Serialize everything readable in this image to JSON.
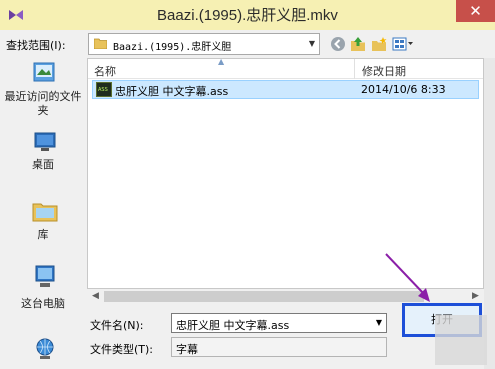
{
  "window": {
    "title": "Baazi.(1995).忠肝义胆.mkv",
    "close_glyph": "✕"
  },
  "lookin": {
    "label": "查找范围(I):",
    "folder": "Baazi.(1995).忠肝义胆"
  },
  "places": [
    {
      "label": "最近访问的文件夹",
      "icon": "recent-places-icon"
    },
    {
      "label": "桌面",
      "icon": "desktop-icon"
    },
    {
      "label": "库",
      "icon": "libraries-icon"
    },
    {
      "label": "这台电脑",
      "icon": "this-pc-icon"
    }
  ],
  "columns": {
    "name": "名称",
    "date": "修改日期"
  },
  "files": [
    {
      "name": "忠肝义胆 中文字幕.ass",
      "date": "2014/10/6 8:33",
      "icon_text": "ASS",
      "selected": true
    }
  ],
  "filename": {
    "label": "文件名(N):",
    "value": "忠肝义胆 中文字幕.ass"
  },
  "filetype": {
    "label": "文件类型(T):",
    "value": "字幕"
  },
  "open_button": {
    "label": "打开"
  },
  "colors": {
    "titlebar": "#f6f0b3",
    "selection": "#cce8ff",
    "annotation_arrow": "#8b1fa8",
    "highlight_border": "#1d4fd8"
  }
}
